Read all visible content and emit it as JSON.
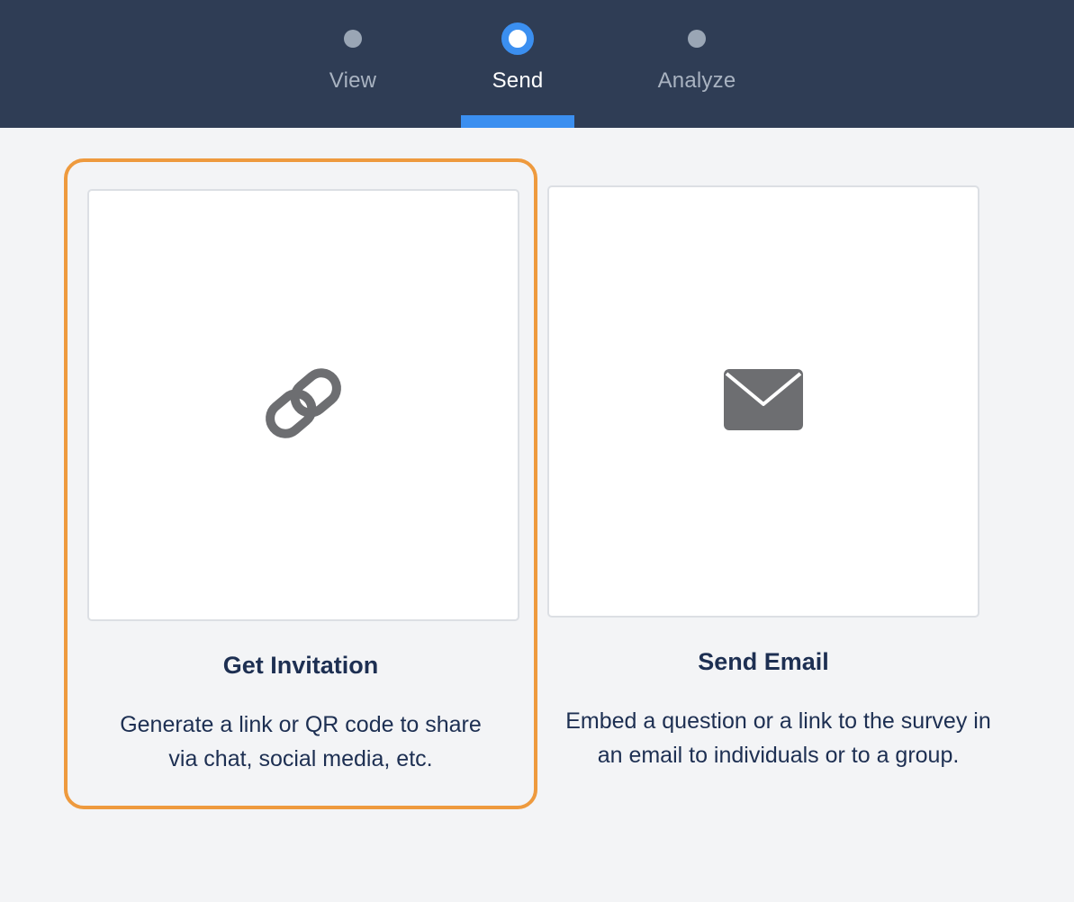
{
  "stepper": {
    "steps": [
      {
        "label": "View",
        "state": "inactive"
      },
      {
        "label": "Send",
        "state": "active"
      },
      {
        "label": "Analyze",
        "state": "inactive"
      }
    ]
  },
  "options": [
    {
      "title": "Get Invitation",
      "description": "Generate a link or QR code to share via chat, social media, etc.",
      "icon": "link-icon",
      "selected": true
    },
    {
      "title": "Send Email",
      "description": "Embed a question or a link to the survey in an email to individuals or to a group.",
      "icon": "envelope-icon",
      "selected": false
    }
  ],
  "colors": {
    "header_bg": "#2f3d55",
    "accent_blue": "#3b8ff0",
    "selection_orange": "#ee9a3e",
    "text_navy": "#1d2f52",
    "icon_gray": "#6d6e71",
    "page_bg": "#f3f4f6"
  }
}
